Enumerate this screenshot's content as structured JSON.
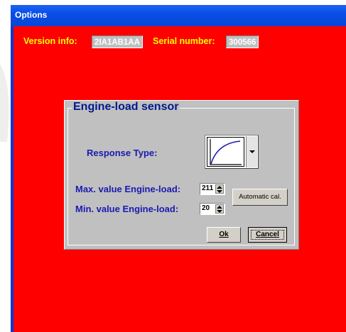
{
  "window": {
    "title": "Options"
  },
  "info": {
    "version_label": "Version info:",
    "version_value": "2IA1AB1AA",
    "serial_label": "Serial number:",
    "serial_value": "300566"
  },
  "dialog": {
    "group_title": "Engine-load sensor",
    "response_type_label": "Response Type:",
    "response_curve_icon": "response-curve-icon",
    "max_label": "Max. value Engine-load:",
    "max_value": "211",
    "min_label": "Min. value Engine-load:",
    "min_value": "20",
    "auto_cal_label": "Automatic cal.",
    "ok_label": "Ok",
    "cancel_label": "Cancel"
  },
  "colors": {
    "client_bg": "#ff0000",
    "info_text": "#ffff00",
    "dialog_bg": "#c0c0c0",
    "label_text": "#1a1ab0",
    "titlebar": "#0a4ee8"
  }
}
